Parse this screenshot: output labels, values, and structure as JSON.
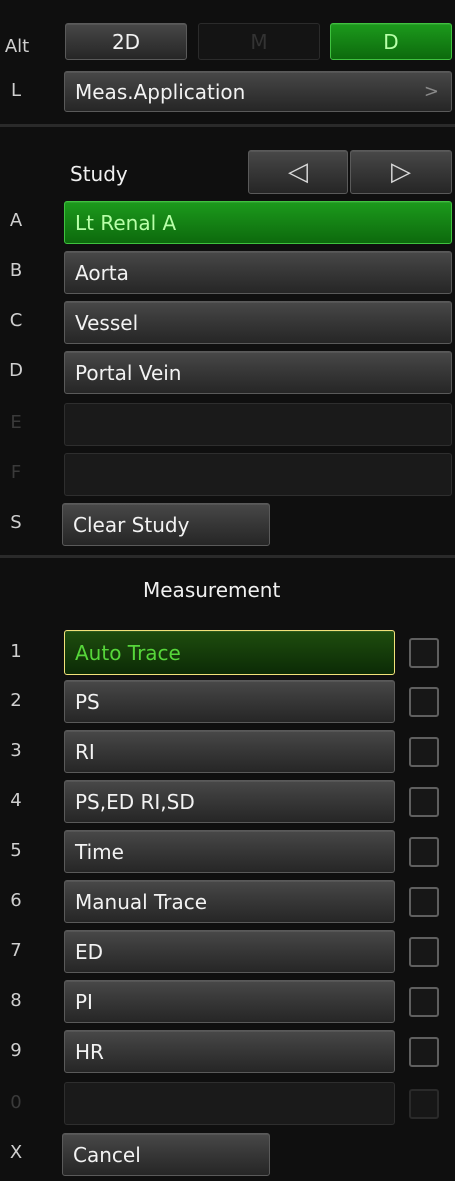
{
  "mode": {
    "alt_key": "Alt",
    "btn_2d": "2D",
    "btn_m": "M",
    "btn_d": "D"
  },
  "app": {
    "key": "L",
    "label": "Meas.Application",
    "chevron": ">"
  },
  "study": {
    "heading": "Study",
    "prev_icon": "◁",
    "next_icon": "▷",
    "items": [
      {
        "key": "A",
        "label": "Lt Renal A"
      },
      {
        "key": "B",
        "label": "Aorta"
      },
      {
        "key": "C",
        "label": "Vessel"
      },
      {
        "key": "D",
        "label": "Portal Vein"
      },
      {
        "key": "E",
        "label": ""
      },
      {
        "key": "F",
        "label": ""
      }
    ],
    "clear_key": "S",
    "clear_label": "Clear Study"
  },
  "measurement": {
    "heading": "Measurement",
    "items": [
      {
        "key": "1",
        "label": "Auto Trace"
      },
      {
        "key": "2",
        "label": "PS"
      },
      {
        "key": "3",
        "label": "RI"
      },
      {
        "key": "4",
        "label": "PS,ED RI,SD"
      },
      {
        "key": "5",
        "label": "Time"
      },
      {
        "key": "6",
        "label": "Manual Trace"
      },
      {
        "key": "7",
        "label": "ED"
      },
      {
        "key": "8",
        "label": "PI"
      },
      {
        "key": "9",
        "label": "HR"
      },
      {
        "key": "0",
        "label": ""
      }
    ],
    "cancel_key": "X",
    "cancel_label": "Cancel"
  }
}
